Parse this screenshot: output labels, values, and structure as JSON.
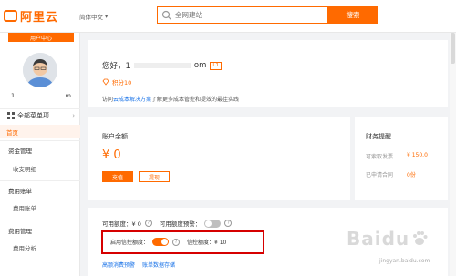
{
  "header": {
    "logo_text": "阿里云",
    "language": "简体中文",
    "search_placeholder": "全网建站",
    "search_button": "搜索"
  },
  "sidebar": {
    "user_center": "用户中心",
    "username_left": "1",
    "username_right": "m",
    "all_products": "全部菜单项",
    "items": [
      {
        "label": "首页"
      },
      {
        "label": "资金管理"
      },
      {
        "label": "收支明细"
      },
      {
        "label": "费用账单"
      },
      {
        "label": "费用账单"
      },
      {
        "label": "费用管理"
      },
      {
        "label": "费用分析"
      }
    ]
  },
  "profile": {
    "greeting_prefix": "您好，1",
    "greeting_suffix": "om",
    "level": "L1",
    "points": "积分10",
    "consult_prefix": "访问",
    "consult_link": "云成本解决方案",
    "consult_suffix": "了解更多成本管控和提效的最佳实践"
  },
  "balance": {
    "title": "账户余额",
    "amount": "¥ 0",
    "recharge": "充值",
    "withdraw": "提现"
  },
  "finance": {
    "title": "财务提醒",
    "rows": [
      {
        "label": "可索取发票",
        "value": "¥ 150.0"
      },
      {
        "label": "已申请合同",
        "value": "0份"
      }
    ]
  },
  "quota": {
    "available_label": "可用额度：¥ 0",
    "warning_label": "可用额度预警：",
    "credit_toggle_label": "启用信控额度：",
    "credit_quota_label": "信控额度：¥ 10"
  },
  "links": {
    "link1": "高额消费预警",
    "link2": "账单数据存储"
  },
  "watermark": {
    "text": "Baidu",
    "sub": "jingyan.baidu.com"
  },
  "colors": {
    "accent": "#ff6a00",
    "highlight": "#d60000",
    "link": "#1a73e8"
  }
}
